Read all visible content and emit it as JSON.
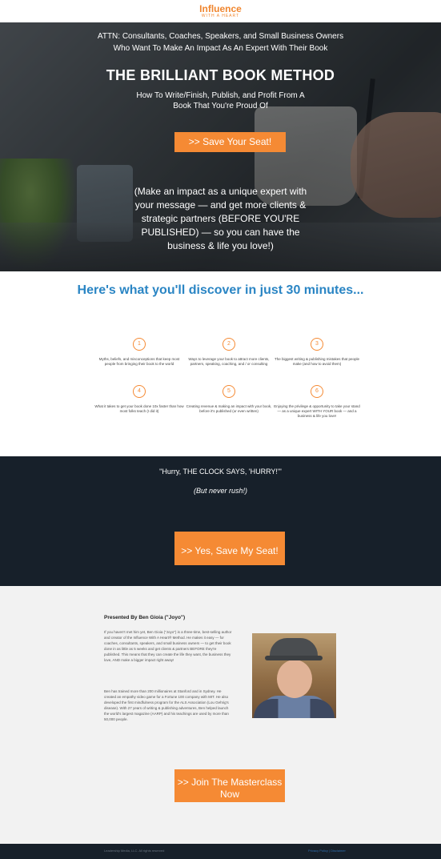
{
  "logo": {
    "title": "Influence",
    "subtitle": "WITH A HEART"
  },
  "hero": {
    "attn": "ATTN: Consultants, Coaches, Speakers, and Small Business Owners Who Want To Make An Impact As An Expert With Their Book",
    "title": "THE BRILLIANT BOOK METHOD",
    "subtitle": "How To Write/Finish, Publish, and Profit From A Book That You're Proud Of",
    "button_label": ">> Save Your Seat!",
    "pitch": "(Make an impact as a unique expert with your message — and get more clients & strategic partners (BEFORE YOU'RE PUBLISHED) — so you can have the business & life you love!)"
  },
  "discover": {
    "title": "Here's what you'll discover in just 30 minutes...",
    "features": [
      {
        "icon": "1",
        "text": "Myths, beliefs, and misconceptions that keep most people from bringing their book to the world"
      },
      {
        "icon": "2",
        "text": "Ways to leverage your book to attract more clients, partners, speaking, coaching, and / or consulting"
      },
      {
        "icon": "3",
        "text": "The biggest writing & publishing mistakes that people make (and how to avoid them)"
      },
      {
        "icon": "4",
        "text": "What it takes to get your book done 10x faster than how most folks teach (I did it)"
      },
      {
        "icon": "5",
        "text": "Creating revenue & making an impact with your book, before it's published (or even written)"
      },
      {
        "icon": "6",
        "text": "Enjoying the privilege & opportunity to take your stand — as a unique expert WITH YOUR book — and a business & life you love!"
      }
    ]
  },
  "cta": {
    "quote": "\"Hurry, THE CLOCK SAYS, 'HURRY!'\"",
    "quote_sub": "(But never rush!)",
    "button_label": ">> Yes, Save My Seat!"
  },
  "presenter": {
    "heading": "Presented By Ben Gioia (\"Joyo\")",
    "bio1": "If you haven't met him yet, Ben Gioia (\"Joyo\") is a three-time, best-selling author and creator of the Influence With A Heart® Method. He makes it easy — for coaches, consultants, speakers, and small business owners — to get their book done in as little as 5 weeks and get clients & partners BEFORE they're published. This means that they can create the life they want, the business they love, AND make a bigger impact right away!",
    "bio2": "Ben has trained more than 200 millionaires at Stanford and in Sydney. He created an empathy video game for a Fortune 100 company with MIT. He also developed the first mindfulness program for the ALS Association (Lou Gehrig's disease). With 27 years of writing & publishing adventures, Ben helped launch the world's largest magazine (AARP) and his teachings are used by more than 50,000 people.",
    "button_label": ">> Join The Masterclass Now"
  },
  "footer": {
    "left": "Leadership Media, LLC. All rights reserved",
    "right": "Privacy Policy | Disclaimer"
  },
  "colors": {
    "accent": "#f58a34",
    "heading_blue": "#2a85c4",
    "dark_bg": "#17202a"
  }
}
